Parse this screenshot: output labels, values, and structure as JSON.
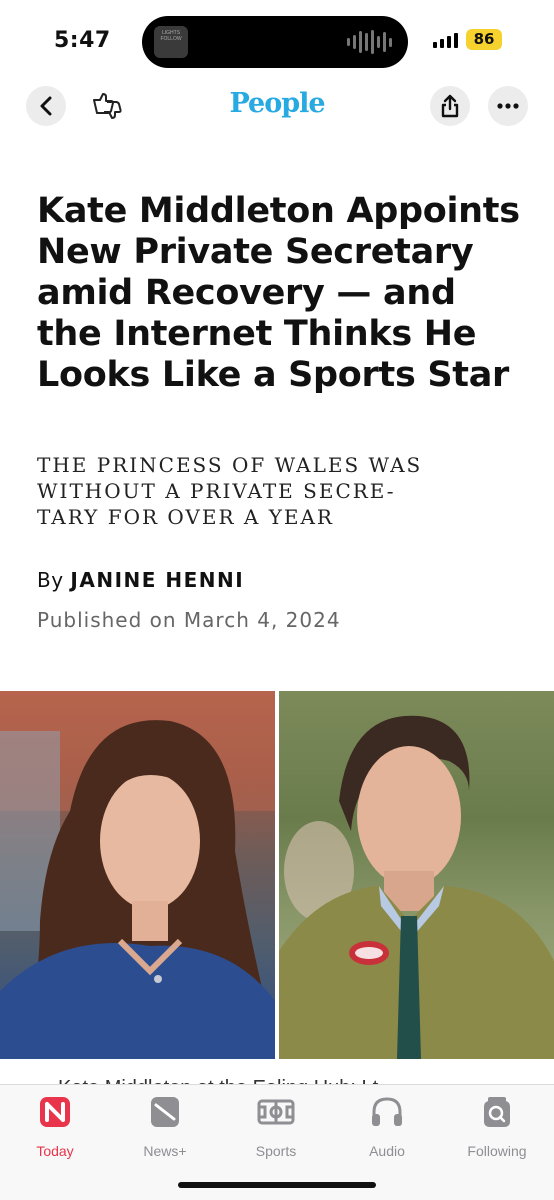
{
  "status_bar": {
    "time": "5:47",
    "battery": "86",
    "island_thumb_text": "LIGHTS FOLLOW"
  },
  "nav": {
    "logo": "People",
    "icons": [
      "chevron-left-icon",
      "reactions-icon",
      "share-icon",
      "more-icon"
    ]
  },
  "article": {
    "headline": "Kate Middleton Appoints New Private Secretary amid Recovery — and the Internet Thinks He Looks Like a Sports Star",
    "subhead_lines": [
      "THE PRINCESS OF WALES WAS",
      "WITHOUT A PRIVATE SECRE-",
      "TARY FOR OVER A YEAR"
    ],
    "byline_prefix": "By",
    "author": "JANINE HENNI",
    "published": "Published on March 4, 2024",
    "caption_peek": "Kate Middleton at the Ealing Hub; Lt"
  },
  "tabbar": {
    "tabs": [
      {
        "label": "Today",
        "icon": "news-today-icon",
        "active": true
      },
      {
        "label": "News+",
        "icon": "news-plus-icon",
        "active": false
      },
      {
        "label": "Sports",
        "icon": "sports-field-icon",
        "active": false
      },
      {
        "label": "Audio",
        "icon": "headphones-icon",
        "active": false
      },
      {
        "label": "Following",
        "icon": "following-search-icon",
        "active": false
      }
    ]
  },
  "colors": {
    "accent": "#e8354b",
    "logo": "#27a9e1",
    "battery": "#f6d22e"
  }
}
